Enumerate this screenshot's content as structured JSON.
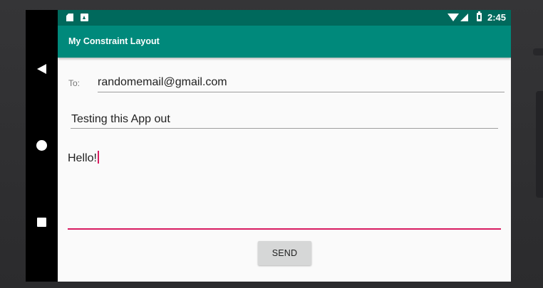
{
  "status_bar": {
    "time": "2:45",
    "icons": [
      "sd-card-icon",
      "a-icon",
      "wifi-icon",
      "signal-icon",
      "battery-icon"
    ]
  },
  "nav_bar": {
    "icons": [
      "back-icon",
      "home-icon",
      "recents-icon"
    ]
  },
  "app_bar": {
    "title": "My Constraint Layout"
  },
  "form": {
    "to_label": "To:",
    "email_value": "randomemail@gmail.com",
    "subject_value": "Testing this App out",
    "message_value": "Hello!",
    "send_label": "SEND"
  },
  "colors": {
    "status_bar": "#00695c",
    "app_bar": "#00897b",
    "accent": "#d81b60",
    "button": "#d6d7d7"
  }
}
